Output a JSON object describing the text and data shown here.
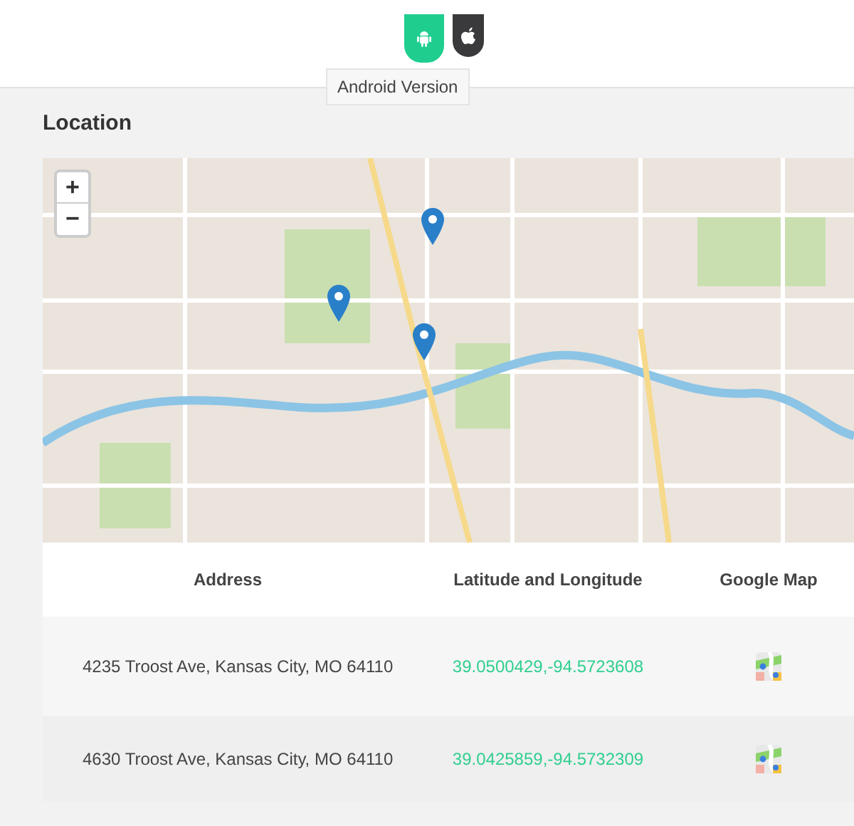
{
  "platform_tabs": [
    {
      "kind": "android",
      "selected": true
    },
    {
      "kind": "apple",
      "selected": false
    }
  ],
  "tooltip": "Android Version",
  "section_title": "Location",
  "map": {
    "zoom_in": "+",
    "zoom_out": "−"
  },
  "table": {
    "columns": [
      "Address",
      "Latitude and Longitude",
      "Google Map"
    ],
    "rows": [
      {
        "address": "4235 Troost Ave, Kansas City, MO 64110",
        "coordinates": "39.0500429,-94.5723608"
      },
      {
        "address": "4630 Troost Ave, Kansas City, MO 64110",
        "coordinates": "39.0425859,-94.5732309"
      }
    ]
  }
}
